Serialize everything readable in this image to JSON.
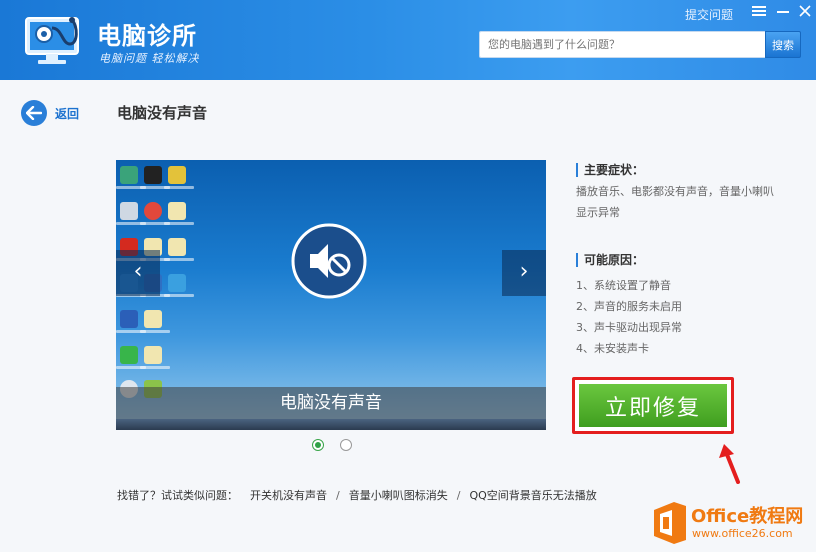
{
  "app": {
    "title": "电脑诊所",
    "slogan": "电脑问题 轻松解决",
    "top_link": "提交问题",
    "menu_icon": "hamburger-icon",
    "minimize_icon": "minimize-icon",
    "close_icon": "close-icon"
  },
  "search": {
    "placeholder": "您的电脑遇到了什么问题？",
    "button_label": "搜索"
  },
  "nav": {
    "back_label": "返回",
    "page_title": "电脑没有声音"
  },
  "carousel": {
    "caption": "电脑没有声音",
    "prev_arrow": "‹",
    "next_arrow": "›",
    "active_index": 0,
    "slide_count": 2
  },
  "symptoms": {
    "title": "主要症状：",
    "text": "播放音乐、电影都没有声音，音量小喇叭显示异常"
  },
  "causes": {
    "title": "可能原因：",
    "items": [
      "1、系统设置了静音",
      "2、声音的服务未启用",
      "3、声卡驱动出现异常",
      "4、未安装声卡"
    ]
  },
  "fix_button": "立即修复",
  "related": {
    "lead": "找错了？试试类似问题：",
    "links": [
      "开关机没有声音",
      "音量小喇叭图标消失",
      "QQ空间背景音乐无法播放"
    ],
    "separator": "/"
  },
  "watermark": {
    "brand": "Office教程网",
    "url": "www.office26.com"
  },
  "colors": {
    "header": "#2b8ee6",
    "accent": "#2a7fd8",
    "fix_green": "#4caf27",
    "highlight_red": "#e41e1e",
    "watermark_orange": "#f07a12"
  }
}
